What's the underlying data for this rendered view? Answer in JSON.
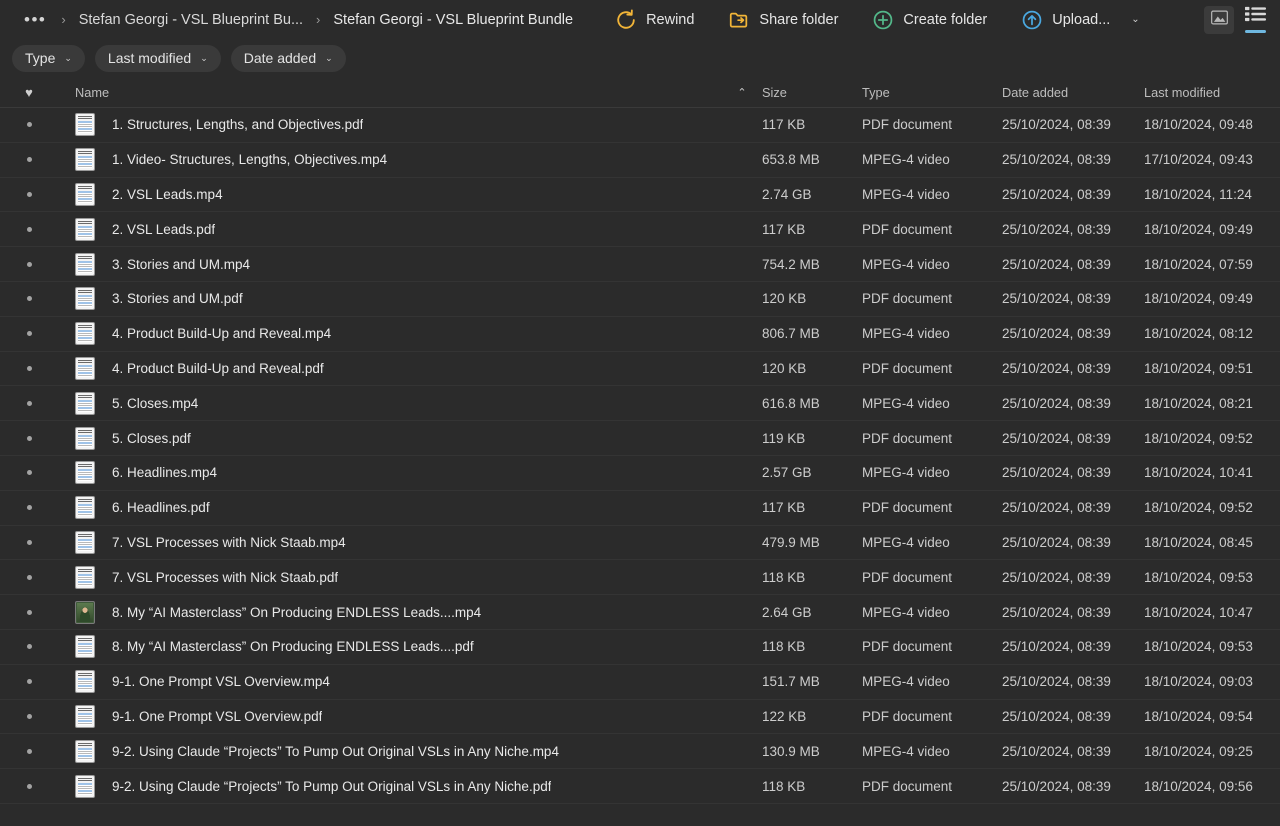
{
  "breadcrumb": {
    "overflow": "•••",
    "separator": "›",
    "items": [
      {
        "label": "Stefan Georgi - VSL Blueprint Bu..."
      },
      {
        "label": "Stefan Georgi - VSL Blueprint Bundle"
      }
    ]
  },
  "toolbar": {
    "rewind_label": "Rewind",
    "share_folder_label": "Share folder",
    "create_folder_label": "Create folder",
    "upload_label": "Upload...",
    "upload_caret": "⌄",
    "colors": {
      "rewind": "#f2b538",
      "share": "#f2b538",
      "create": "#53b88a",
      "upload": "#4aa8e0",
      "active_underline": "#6fb8e0"
    }
  },
  "filters": [
    {
      "label": "Type",
      "caret": "⌄"
    },
    {
      "label": "Last modified",
      "caret": "⌄"
    },
    {
      "label": "Date added",
      "caret": "⌄"
    }
  ],
  "columns": {
    "favorite_icon": "♥",
    "name": "Name",
    "sort_indicator": "⌃",
    "size": "Size",
    "type": "Type",
    "date_added": "Date added",
    "last_modified": "Last modified"
  },
  "files": [
    {
      "name": "1. Structures, Lengths, and Objectives.pdf",
      "size": "117 KB",
      "type": "PDF document",
      "date_added": "25/10/2024, 08:39",
      "last_modified": "18/10/2024, 09:48",
      "icon": "doc"
    },
    {
      "name": "1. Video- Structures, Lengths, Objectives.mp4",
      "size": "653.8 MB",
      "type": "MPEG-4 video",
      "date_added": "25/10/2024, 08:39",
      "last_modified": "17/10/2024, 09:43",
      "icon": "doc"
    },
    {
      "name": "2. VSL Leads.mp4",
      "size": "2.74 GB",
      "type": "MPEG-4 video",
      "date_added": "25/10/2024, 08:39",
      "last_modified": "18/10/2024, 11:24",
      "icon": "doc"
    },
    {
      "name": "2. VSL Leads.pdf",
      "size": "117 KB",
      "type": "PDF document",
      "date_added": "25/10/2024, 08:39",
      "last_modified": "18/10/2024, 09:49",
      "icon": "doc"
    },
    {
      "name": "3. Stories and UM.mp4",
      "size": "754.2 MB",
      "type": "MPEG-4 video",
      "date_added": "25/10/2024, 08:39",
      "last_modified": "18/10/2024, 07:59",
      "icon": "doc"
    },
    {
      "name": "3. Stories and UM.pdf",
      "size": "120 KB",
      "type": "PDF document",
      "date_added": "25/10/2024, 08:39",
      "last_modified": "18/10/2024, 09:49",
      "icon": "doc"
    },
    {
      "name": "4. Product Build-Up and Reveal.mp4",
      "size": "806.7 MB",
      "type": "MPEG-4 video",
      "date_added": "25/10/2024, 08:39",
      "last_modified": "18/10/2024, 08:12",
      "icon": "doc"
    },
    {
      "name": "4. Product Build-Up and Reveal.pdf",
      "size": "120 KB",
      "type": "PDF document",
      "date_added": "25/10/2024, 08:39",
      "last_modified": "18/10/2024, 09:51",
      "icon": "doc"
    },
    {
      "name": "5. Closes.mp4",
      "size": "616.8 MB",
      "type": "MPEG-4 video",
      "date_added": "25/10/2024, 08:39",
      "last_modified": "18/10/2024, 08:21",
      "icon": "doc"
    },
    {
      "name": "5. Closes.pdf",
      "size": "119 KB",
      "type": "PDF document",
      "date_added": "25/10/2024, 08:39",
      "last_modified": "18/10/2024, 09:52",
      "icon": "doc"
    },
    {
      "name": "6. Headlines.mp4",
      "size": "2.57 GB",
      "type": "MPEG-4 video",
      "date_added": "25/10/2024, 08:39",
      "last_modified": "18/10/2024, 10:41",
      "icon": "doc"
    },
    {
      "name": "6. Headlines.pdf",
      "size": "117 KB",
      "type": "PDF document",
      "date_added": "25/10/2024, 08:39",
      "last_modified": "18/10/2024, 09:52",
      "icon": "doc"
    },
    {
      "name": "7. VSL Processes with Nick Staab.mp4",
      "size": "479.9 MB",
      "type": "MPEG-4 video",
      "date_added": "25/10/2024, 08:39",
      "last_modified": "18/10/2024, 08:45",
      "icon": "doc"
    },
    {
      "name": "7. VSL Processes with Nick Staab.pdf",
      "size": "118 KB",
      "type": "PDF document",
      "date_added": "25/10/2024, 08:39",
      "last_modified": "18/10/2024, 09:53",
      "icon": "doc"
    },
    {
      "name": "8. My “AI Masterclass” On Producing ENDLESS Leads....mp4",
      "size": "2.64 GB",
      "type": "MPEG-4 video",
      "date_added": "25/10/2024, 08:39",
      "last_modified": "18/10/2024, 10:47",
      "icon": "photo"
    },
    {
      "name": "8. My “AI Masterclass” On Producing ENDLESS Leads....pdf",
      "size": "118 KB",
      "type": "PDF document",
      "date_added": "25/10/2024, 08:39",
      "last_modified": "18/10/2024, 09:53",
      "icon": "doc"
    },
    {
      "name": "9-1. One Prompt VSL Overview.mp4",
      "size": "151.7 MB",
      "type": "MPEG-4 video",
      "date_added": "25/10/2024, 08:39",
      "last_modified": "18/10/2024, 09:03",
      "icon": "doc"
    },
    {
      "name": "9-1. One Prompt VSL Overview.pdf",
      "size": "122 KB",
      "type": "PDF document",
      "date_added": "25/10/2024, 08:39",
      "last_modified": "18/10/2024, 09:54",
      "icon": "doc"
    },
    {
      "name": "9-2. Using Claude “Projects” To Pump Out Original VSLs in Any Niche.mp4",
      "size": "130.9 MB",
      "type": "MPEG-4 video",
      "date_added": "25/10/2024, 08:39",
      "last_modified": "18/10/2024, 09:25",
      "icon": "doc"
    },
    {
      "name": "9-2. Using Claude “Projects” To Pump Out Original VSLs in Any Niche.pdf",
      "size": "118 KB",
      "type": "PDF document",
      "date_added": "25/10/2024, 08:39",
      "last_modified": "18/10/2024, 09:56",
      "icon": "doc"
    }
  ]
}
